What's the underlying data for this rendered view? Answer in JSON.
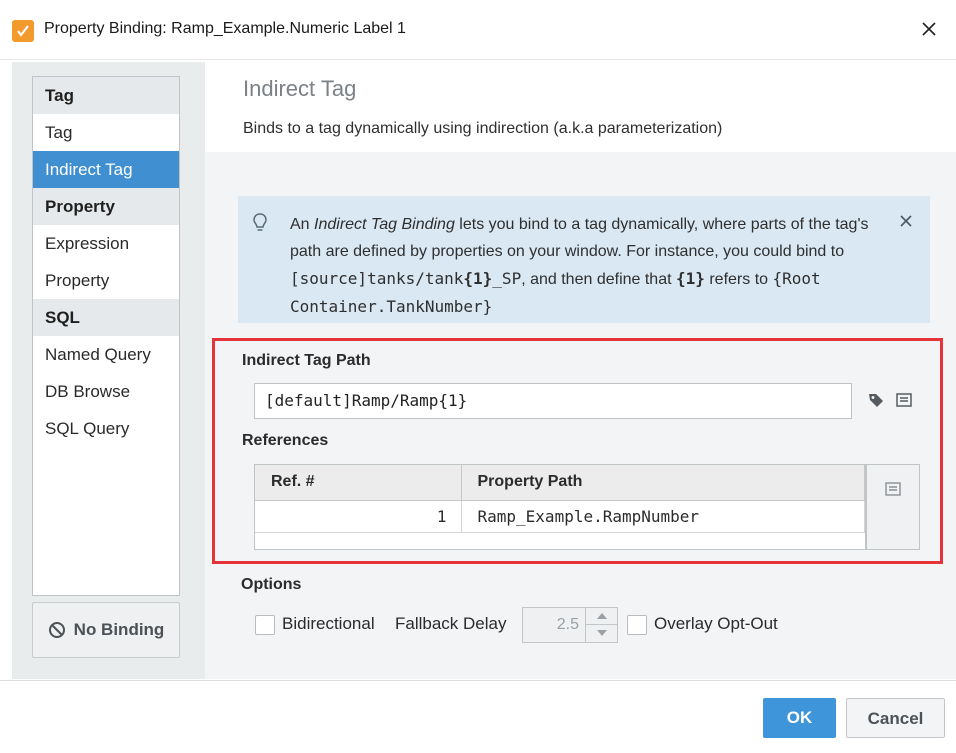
{
  "window": {
    "title": "Property Binding: Ramp_Example.Numeric Label 1",
    "accent_color": "#f39a2c"
  },
  "nav": {
    "sections": [
      {
        "header": "Tag",
        "items": [
          {
            "label": "Tag"
          },
          {
            "label": "Indirect Tag",
            "active": true
          }
        ]
      },
      {
        "header": "Property",
        "items": [
          {
            "label": "Expression"
          },
          {
            "label": "Property"
          }
        ]
      },
      {
        "header": "SQL",
        "items": [
          {
            "label": "Named Query"
          },
          {
            "label": "DB Browse"
          },
          {
            "label": "SQL Query"
          }
        ]
      }
    ],
    "no_binding_label": "No Binding"
  },
  "header": {
    "title": "Indirect Tag",
    "subtitle": "Binds to a tag dynamically using indirection (a.k.a parameterization)"
  },
  "info": {
    "part1": "An ",
    "em": "Indirect Tag Binding",
    "part2": " lets you bind to a tag dynamically, where parts of the tag's path are defined by properties on your window. For instance, you could bind to ",
    "code1a": "[source]tanks/tank",
    "code1b": "{1}",
    "code1c": "_SP",
    "part3": ", and then define that ",
    "bold2": "{1}",
    "part4": " refers to ",
    "code2": "{Root Container.TankNumber}"
  },
  "indirect": {
    "path_label": "Indirect Tag Path",
    "path_value": "[default]Ramp/Ramp{1}",
    "references_label": "References",
    "columns": [
      "Ref. #",
      "Property Path"
    ],
    "rows": [
      {
        "ref": "1",
        "path": "Ramp_Example.RampNumber"
      }
    ]
  },
  "options": {
    "label": "Options",
    "bidirectional_label": "Bidirectional",
    "fallback_label": "Fallback Delay",
    "fallback_value": "2.5",
    "overlay_label": "Overlay Opt-Out"
  },
  "footer": {
    "ok_label": "OK",
    "cancel_label": "Cancel"
  },
  "colors": {
    "selection": "#3f8fd1",
    "info_background": "#d9e8f3",
    "highlight_border": "#e4343a",
    "ok_button": "#3f95d9"
  }
}
